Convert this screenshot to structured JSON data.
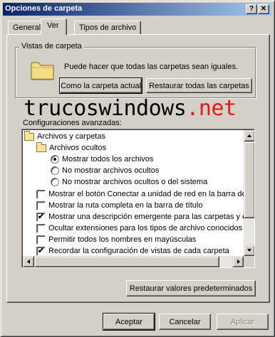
{
  "window": {
    "title": "Opciones de carpeta",
    "help_glyph": "?",
    "close_glyph": "✕"
  },
  "tabs": [
    {
      "label": "General"
    },
    {
      "label": "Ver"
    },
    {
      "label": "Tipos de archivo"
    }
  ],
  "folder_views": {
    "group_label": "Vistas de carpeta",
    "description": "Puede hacer que todas las carpetas sean iguales.",
    "like_current_button": "Como la carpeta actual",
    "reset_all_button": "Restaurar todas las carpetas"
  },
  "watermark": {
    "text": "trucoswindows",
    "accent": ".net"
  },
  "advanced": {
    "label": "Configuraciones avanzadas:",
    "items": [
      {
        "type": "folder",
        "label": "Archivos y carpetas"
      },
      {
        "type": "folder",
        "label": "Archivos ocultos"
      },
      {
        "type": "radio",
        "checked": true,
        "label": "Mostrar todos los archivos"
      },
      {
        "type": "radio",
        "checked": false,
        "label": "No mostrar archivos ocultos"
      },
      {
        "type": "radio",
        "checked": false,
        "label": "No mostrar archivos ocultos o del sistema"
      },
      {
        "type": "check",
        "checked": false,
        "label": "Mostrar el botón Conectar a unidad de red en la barra de"
      },
      {
        "type": "check",
        "checked": false,
        "label": "Mostrar la ruta completa en la barra de título"
      },
      {
        "type": "check",
        "checked": true,
        "label": "Mostrar una descripción emergente para las carpetas y el"
      },
      {
        "type": "check",
        "checked": false,
        "label": "Ocultar extensiones para los tipos de archivo conocidos"
      },
      {
        "type": "check",
        "checked": false,
        "label": "Permitir todos los nombres en mayúsculas"
      },
      {
        "type": "check",
        "checked": true,
        "label": "Recordar la configuración de vistas de cada carpeta"
      }
    ],
    "restore_defaults_button": "Restaurar valores predeterminados"
  },
  "footer": {
    "accept": "Aceptar",
    "cancel": "Cancelar",
    "apply": "Aplicar"
  }
}
